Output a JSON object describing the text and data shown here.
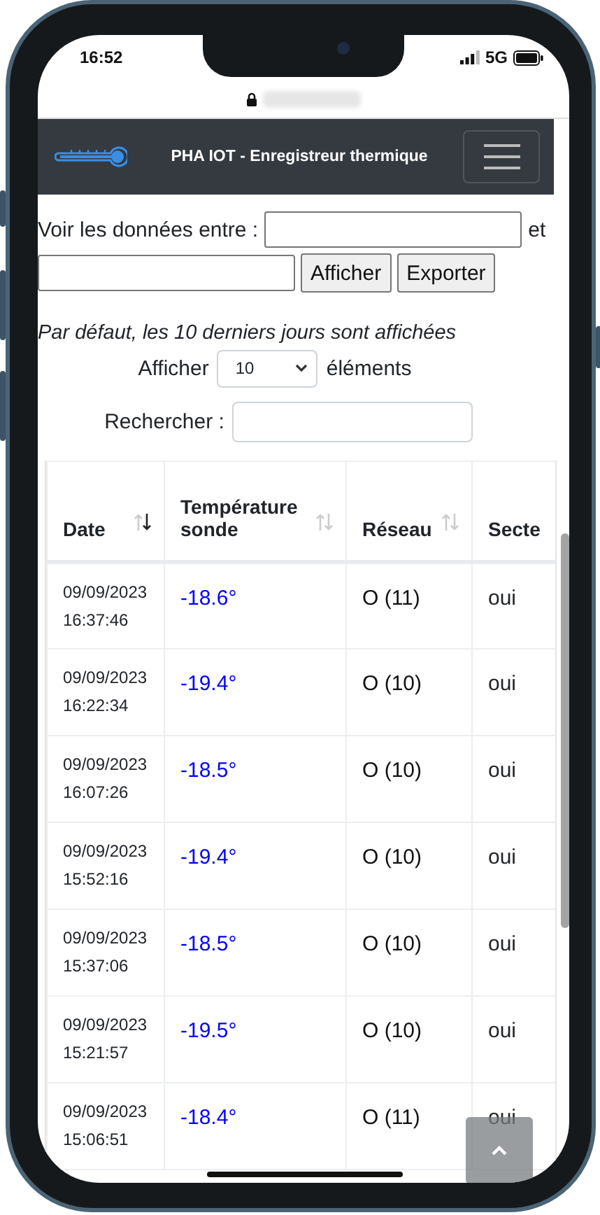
{
  "status_bar": {
    "time": "16:52",
    "network": "5G"
  },
  "navbar": {
    "title": "PHA IOT - Enregistreur thermique"
  },
  "filter": {
    "label": "Voir les données entre :",
    "conjunction": "et",
    "buttons": [
      "Afficher",
      "Exporter"
    ],
    "note": "Par défaut, les 10 derniers jours sont affichées"
  },
  "page_length": {
    "label_before": "Afficher",
    "value": "10",
    "label_after": "éléments"
  },
  "search": {
    "label": "Rechercher :"
  },
  "table": {
    "columns": [
      {
        "label": "Date",
        "sorted": true
      },
      {
        "label": "Température sonde",
        "sorted": false
      },
      {
        "label": "Réseau",
        "sorted": false
      },
      {
        "label": "Secte"
      }
    ],
    "rows": [
      [
        "09/09/2023 16:37:46",
        "-18.6°",
        "O (11)",
        "oui"
      ],
      [
        "09/09/2023 16:22:34",
        "-19.4°",
        "O (10)",
        "oui"
      ],
      [
        "09/09/2023 16:07:26",
        "-18.5°",
        "O (10)",
        "oui"
      ],
      [
        "09/09/2023 15:52:16",
        "-19.4°",
        "O (10)",
        "oui"
      ],
      [
        "09/09/2023 15:37:06",
        "-18.5°",
        "O (10)",
        "oui"
      ],
      [
        "09/09/2023 15:21:57",
        "-19.5°",
        "O (10)",
        "oui"
      ],
      [
        "09/09/2023 15:06:51",
        "-18.4°",
        "O (11)",
        "oui"
      ]
    ]
  }
}
